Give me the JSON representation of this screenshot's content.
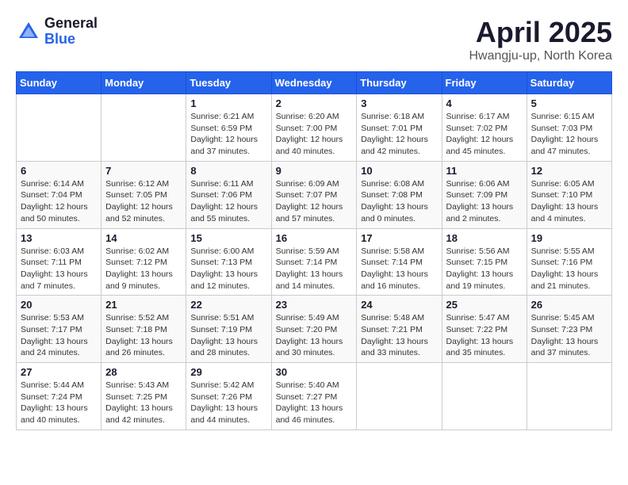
{
  "header": {
    "logo_general": "General",
    "logo_blue": "Blue",
    "month": "April 2025",
    "location": "Hwangju-up, North Korea"
  },
  "weekdays": [
    "Sunday",
    "Monday",
    "Tuesday",
    "Wednesday",
    "Thursday",
    "Friday",
    "Saturday"
  ],
  "weeks": [
    [
      {
        "day": "",
        "info": ""
      },
      {
        "day": "",
        "info": ""
      },
      {
        "day": "1",
        "info": "Sunrise: 6:21 AM\nSunset: 6:59 PM\nDaylight: 12 hours\nand 37 minutes."
      },
      {
        "day": "2",
        "info": "Sunrise: 6:20 AM\nSunset: 7:00 PM\nDaylight: 12 hours\nand 40 minutes."
      },
      {
        "day": "3",
        "info": "Sunrise: 6:18 AM\nSunset: 7:01 PM\nDaylight: 12 hours\nand 42 minutes."
      },
      {
        "day": "4",
        "info": "Sunrise: 6:17 AM\nSunset: 7:02 PM\nDaylight: 12 hours\nand 45 minutes."
      },
      {
        "day": "5",
        "info": "Sunrise: 6:15 AM\nSunset: 7:03 PM\nDaylight: 12 hours\nand 47 minutes."
      }
    ],
    [
      {
        "day": "6",
        "info": "Sunrise: 6:14 AM\nSunset: 7:04 PM\nDaylight: 12 hours\nand 50 minutes."
      },
      {
        "day": "7",
        "info": "Sunrise: 6:12 AM\nSunset: 7:05 PM\nDaylight: 12 hours\nand 52 minutes."
      },
      {
        "day": "8",
        "info": "Sunrise: 6:11 AM\nSunset: 7:06 PM\nDaylight: 12 hours\nand 55 minutes."
      },
      {
        "day": "9",
        "info": "Sunrise: 6:09 AM\nSunset: 7:07 PM\nDaylight: 12 hours\nand 57 minutes."
      },
      {
        "day": "10",
        "info": "Sunrise: 6:08 AM\nSunset: 7:08 PM\nDaylight: 13 hours\nand 0 minutes."
      },
      {
        "day": "11",
        "info": "Sunrise: 6:06 AM\nSunset: 7:09 PM\nDaylight: 13 hours\nand 2 minutes."
      },
      {
        "day": "12",
        "info": "Sunrise: 6:05 AM\nSunset: 7:10 PM\nDaylight: 13 hours\nand 4 minutes."
      }
    ],
    [
      {
        "day": "13",
        "info": "Sunrise: 6:03 AM\nSunset: 7:11 PM\nDaylight: 13 hours\nand 7 minutes."
      },
      {
        "day": "14",
        "info": "Sunrise: 6:02 AM\nSunset: 7:12 PM\nDaylight: 13 hours\nand 9 minutes."
      },
      {
        "day": "15",
        "info": "Sunrise: 6:00 AM\nSunset: 7:13 PM\nDaylight: 13 hours\nand 12 minutes."
      },
      {
        "day": "16",
        "info": "Sunrise: 5:59 AM\nSunset: 7:14 PM\nDaylight: 13 hours\nand 14 minutes."
      },
      {
        "day": "17",
        "info": "Sunrise: 5:58 AM\nSunset: 7:14 PM\nDaylight: 13 hours\nand 16 minutes."
      },
      {
        "day": "18",
        "info": "Sunrise: 5:56 AM\nSunset: 7:15 PM\nDaylight: 13 hours\nand 19 minutes."
      },
      {
        "day": "19",
        "info": "Sunrise: 5:55 AM\nSunset: 7:16 PM\nDaylight: 13 hours\nand 21 minutes."
      }
    ],
    [
      {
        "day": "20",
        "info": "Sunrise: 5:53 AM\nSunset: 7:17 PM\nDaylight: 13 hours\nand 24 minutes."
      },
      {
        "day": "21",
        "info": "Sunrise: 5:52 AM\nSunset: 7:18 PM\nDaylight: 13 hours\nand 26 minutes."
      },
      {
        "day": "22",
        "info": "Sunrise: 5:51 AM\nSunset: 7:19 PM\nDaylight: 13 hours\nand 28 minutes."
      },
      {
        "day": "23",
        "info": "Sunrise: 5:49 AM\nSunset: 7:20 PM\nDaylight: 13 hours\nand 30 minutes."
      },
      {
        "day": "24",
        "info": "Sunrise: 5:48 AM\nSunset: 7:21 PM\nDaylight: 13 hours\nand 33 minutes."
      },
      {
        "day": "25",
        "info": "Sunrise: 5:47 AM\nSunset: 7:22 PM\nDaylight: 13 hours\nand 35 minutes."
      },
      {
        "day": "26",
        "info": "Sunrise: 5:45 AM\nSunset: 7:23 PM\nDaylight: 13 hours\nand 37 minutes."
      }
    ],
    [
      {
        "day": "27",
        "info": "Sunrise: 5:44 AM\nSunset: 7:24 PM\nDaylight: 13 hours\nand 40 minutes."
      },
      {
        "day": "28",
        "info": "Sunrise: 5:43 AM\nSunset: 7:25 PM\nDaylight: 13 hours\nand 42 minutes."
      },
      {
        "day": "29",
        "info": "Sunrise: 5:42 AM\nSunset: 7:26 PM\nDaylight: 13 hours\nand 44 minutes."
      },
      {
        "day": "30",
        "info": "Sunrise: 5:40 AM\nSunset: 7:27 PM\nDaylight: 13 hours\nand 46 minutes."
      },
      {
        "day": "",
        "info": ""
      },
      {
        "day": "",
        "info": ""
      },
      {
        "day": "",
        "info": ""
      }
    ]
  ]
}
